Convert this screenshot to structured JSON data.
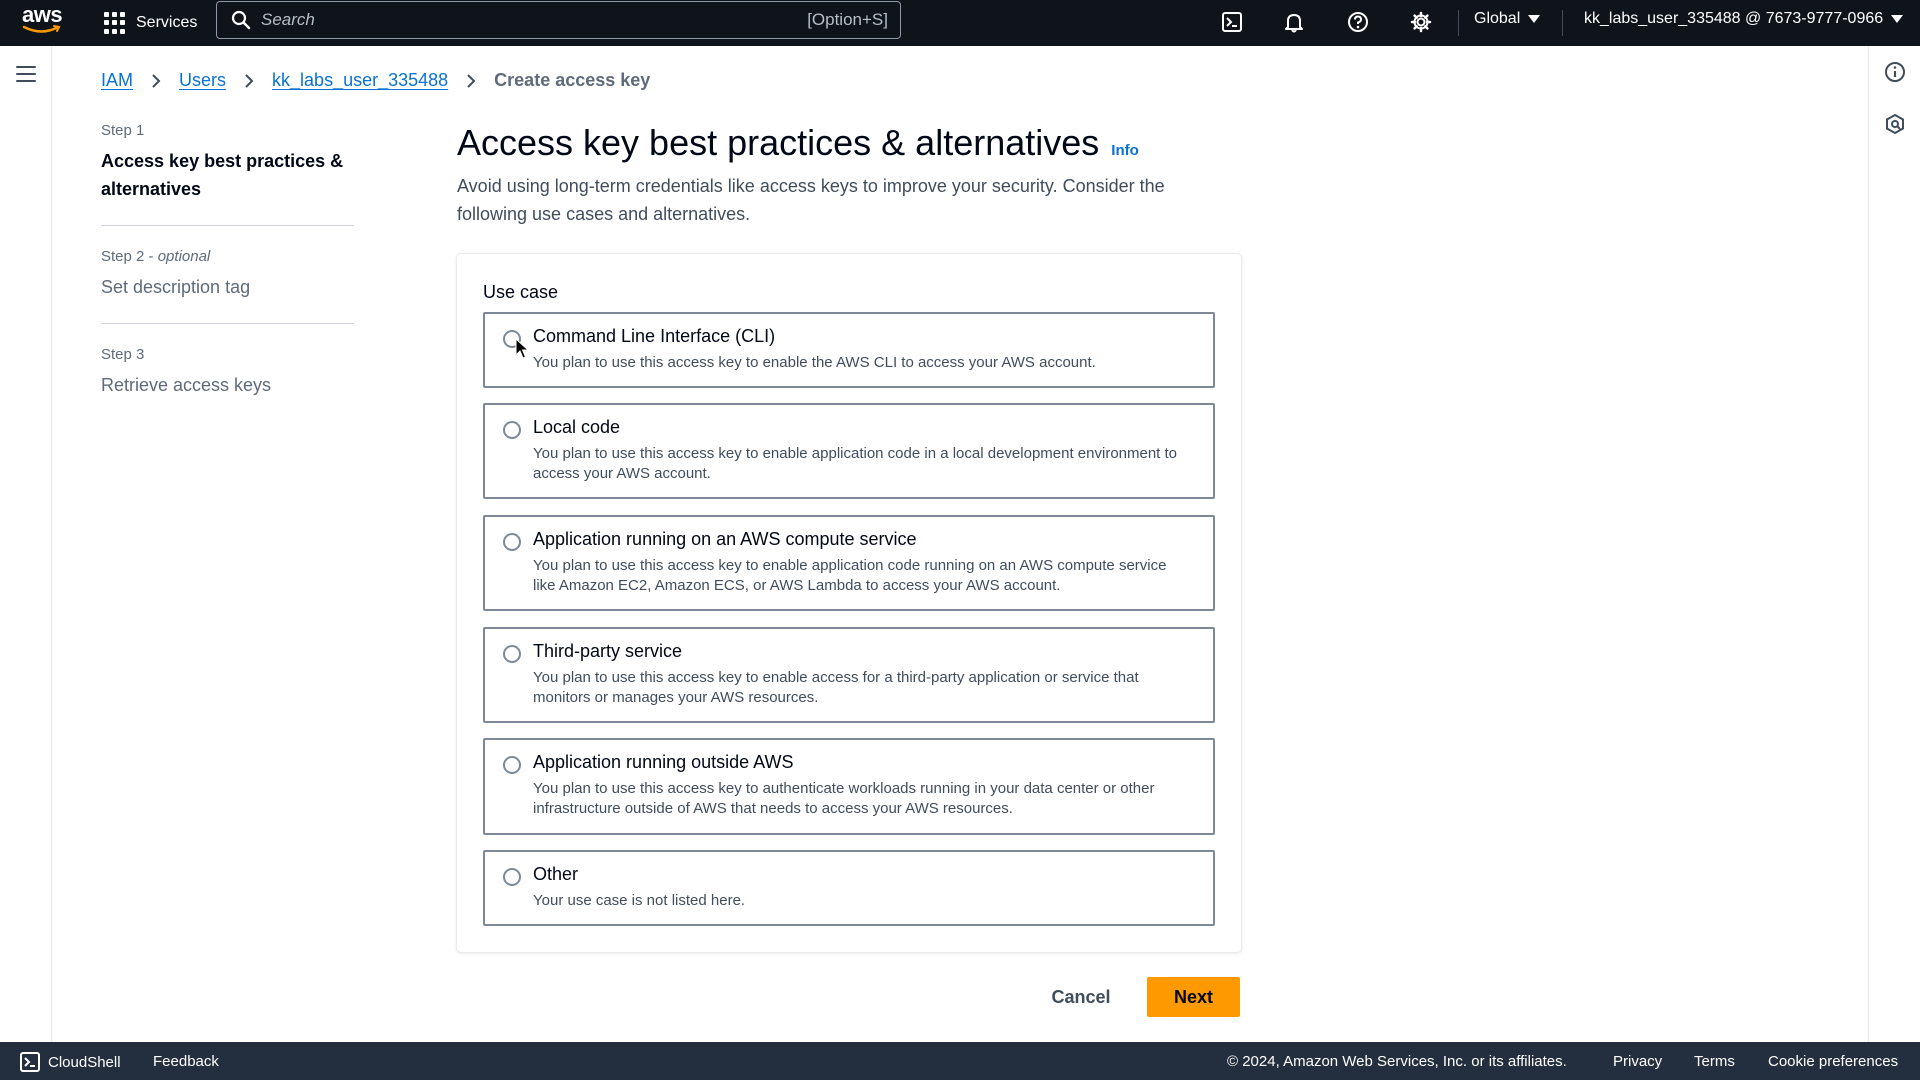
{
  "topnav": {
    "logo_text": "aws",
    "services_label": "Services",
    "search_placeholder": "Search",
    "search_shortcut": "[Option+S]",
    "region_label": "Global",
    "account_label": "kk_labs_user_335488 @ 7673-9777-0966",
    "icons": [
      "cloudshell-icon",
      "bell-icon",
      "help-icon",
      "gear-icon"
    ]
  },
  "breadcrumb": {
    "items": [
      "IAM",
      "Users",
      "kk_labs_user_335488"
    ],
    "current": "Create access key"
  },
  "steps": [
    {
      "num": "Step 1",
      "optional": "",
      "title": "Access key best practices & alternatives",
      "active": true
    },
    {
      "num": "Step 2",
      "optional": "optional",
      "title": "Set description tag",
      "active": false
    },
    {
      "num": "Step 3",
      "optional": "",
      "title": "Retrieve access keys",
      "active": false
    }
  ],
  "main": {
    "title": "Access key best practices & alternatives",
    "info_label": "Info",
    "description": "Avoid using long-term credentials like access keys to improve your security. Consider the following use cases and alternatives."
  },
  "use_case": {
    "label": "Use case",
    "options": [
      {
        "title": "Command Line Interface (CLI)",
        "desc": "You plan to use this access key to enable the AWS CLI to access your AWS account."
      },
      {
        "title": "Local code",
        "desc": "You plan to use this access key to enable application code in a local development environment to access your AWS account."
      },
      {
        "title": "Application running on an AWS compute service",
        "desc": "You plan to use this access key to enable application code running on an AWS compute service like Amazon EC2, Amazon ECS, or AWS Lambda to access your AWS account."
      },
      {
        "title": "Third-party service",
        "desc": "You plan to use this access key to enable access for a third-party application or service that monitors or manages your AWS resources."
      },
      {
        "title": "Application running outside AWS",
        "desc": "You plan to use this access key to authenticate workloads running in your data center or other infrastructure outside of AWS that needs to access your AWS resources."
      },
      {
        "title": "Other",
        "desc": "Your use case is not listed here."
      }
    ]
  },
  "actions": {
    "cancel_label": "Cancel",
    "next_label": "Next",
    "next_color": "#ff9900"
  },
  "footer": {
    "cloudshell_label": "CloudShell",
    "feedback_label": "Feedback",
    "copyright": "© 2024, Amazon Web Services, Inc. or its affiliates.",
    "links": [
      "Privacy",
      "Terms",
      "Cookie preferences"
    ]
  }
}
